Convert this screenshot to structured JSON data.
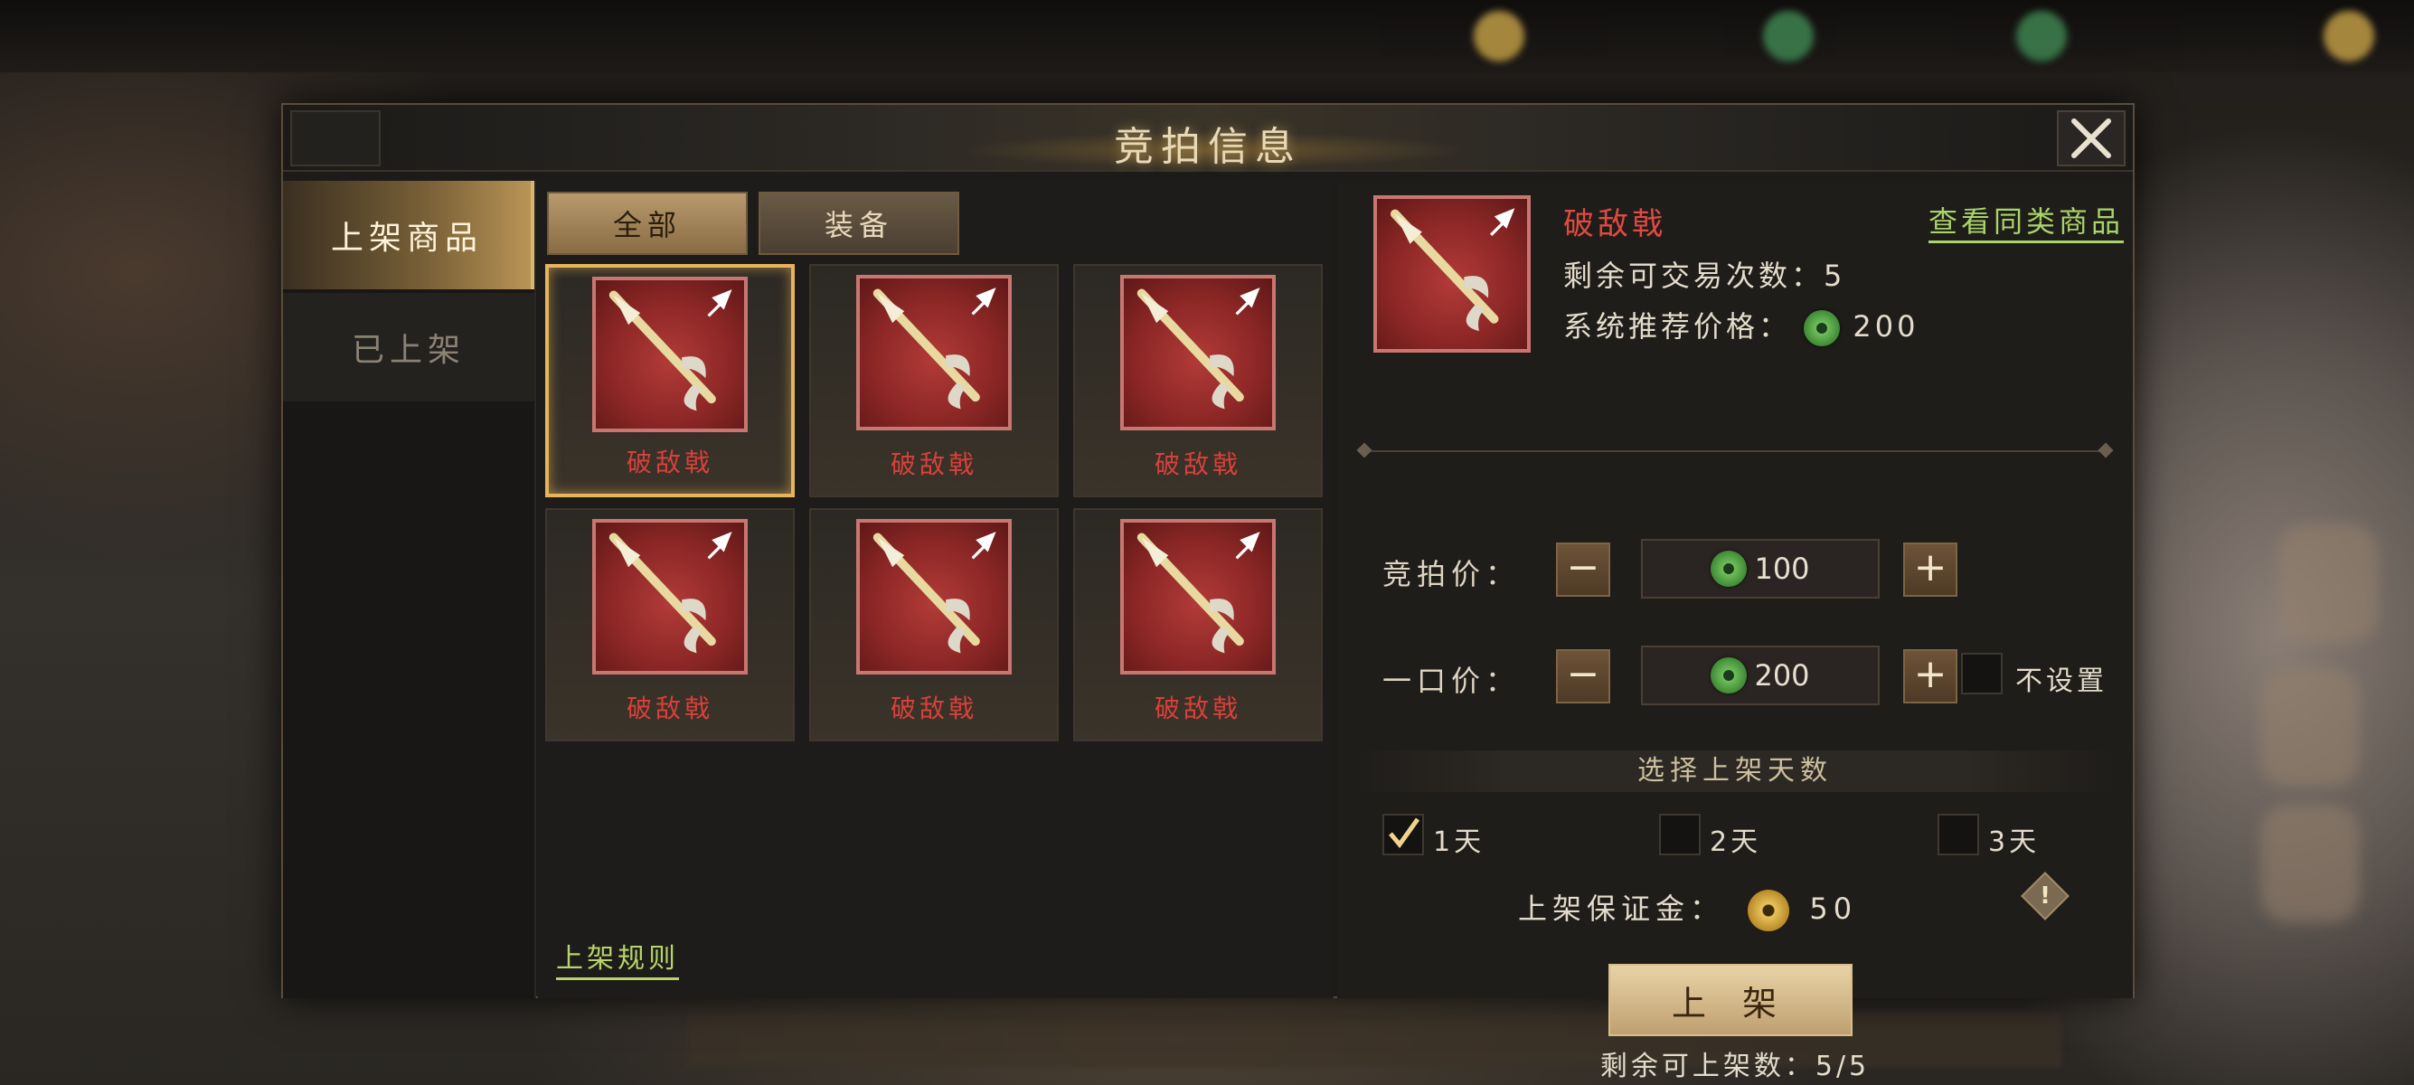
{
  "dialog": {
    "title": "竞拍信息"
  },
  "sidebar": {
    "tabs": [
      {
        "label": "上架商品",
        "active": true
      },
      {
        "label": "已上架",
        "active": false
      }
    ]
  },
  "filters": [
    {
      "label": "全部",
      "active": true
    },
    {
      "label": "装备",
      "active": false
    }
  ],
  "items": [
    {
      "name": "破敌戟",
      "selected": true,
      "icon": "halberd-icon"
    },
    {
      "name": "破敌戟",
      "selected": false,
      "icon": "halberd-icon"
    },
    {
      "name": "破敌戟",
      "selected": false,
      "icon": "halberd-icon"
    },
    {
      "name": "破敌戟",
      "selected": false,
      "icon": "halberd-icon"
    },
    {
      "name": "破敌戟",
      "selected": false,
      "icon": "halberd-icon"
    },
    {
      "name": "破敌戟",
      "selected": false,
      "icon": "halberd-icon"
    }
  ],
  "rules_link": "上架规则",
  "detail": {
    "name": "破敌戟",
    "similar_link": "查看同类商品",
    "trade_count_label": "剩余可交易次数：",
    "trade_count": "5",
    "recommend_label": "系统推荐价格：",
    "recommend_price": "200"
  },
  "pricing": {
    "bid_label": "竞拍价：",
    "bid_value": "100",
    "buyout_label": "一口价：",
    "buyout_value": "200",
    "no_set_label": "不设置",
    "no_set_checked": false
  },
  "days": {
    "header": "选择上架天数",
    "options": [
      {
        "label": "1天",
        "checked": true
      },
      {
        "label": "2天",
        "checked": false
      },
      {
        "label": "3天",
        "checked": false
      }
    ]
  },
  "deposit": {
    "label": "上架保证金：",
    "value": "50"
  },
  "list_button": "上 架",
  "remaining_label": "剩余可上架数：",
  "remaining_value": "5/5",
  "colors": {
    "accent_gold": "#e6b45a",
    "item_red": "#d9403a",
    "link_green": "#a9d46a"
  }
}
